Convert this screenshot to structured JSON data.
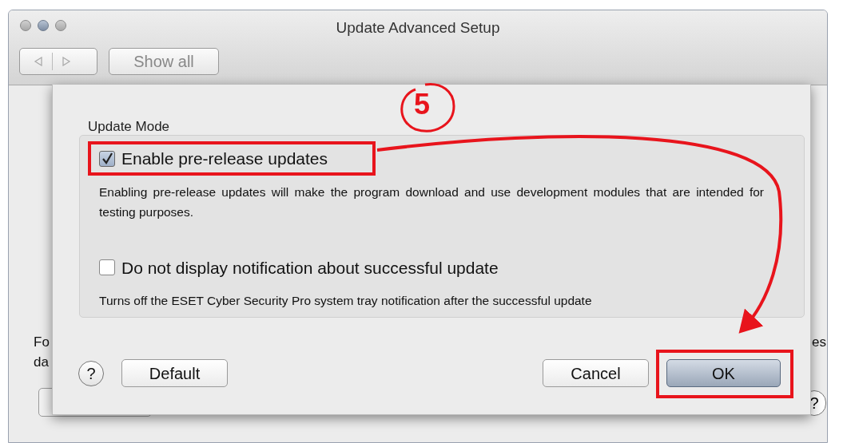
{
  "window": {
    "title": "Update Advanced Setup"
  },
  "toolbar": {
    "show_all": "Show all"
  },
  "background": {
    "fragments": [
      {
        "text": "Fo"
      },
      {
        "text": "es"
      },
      {
        "text": "da"
      }
    ],
    "help": "?"
  },
  "sheet": {
    "group_label": "Update Mode",
    "options": [
      {
        "label": "Enable pre-release updates",
        "description": "Enabling pre-release updates will make the program download and use development modules that are intended for testing purposes.",
        "checked": true
      },
      {
        "label": "Do not display notification about successful update",
        "description": "Turns off the ESET Cyber Security Pro system tray notification after the successful update",
        "checked": false
      }
    ],
    "buttons": [
      {
        "kind": "help",
        "label": "?"
      },
      {
        "kind": "push",
        "label": "Default",
        "default": false
      },
      {
        "kind": "spacer"
      },
      {
        "kind": "push",
        "label": "Cancel",
        "default": false
      },
      {
        "kind": "push",
        "label": "OK",
        "default": true
      }
    ]
  },
  "annotation": {
    "step": "5"
  }
}
